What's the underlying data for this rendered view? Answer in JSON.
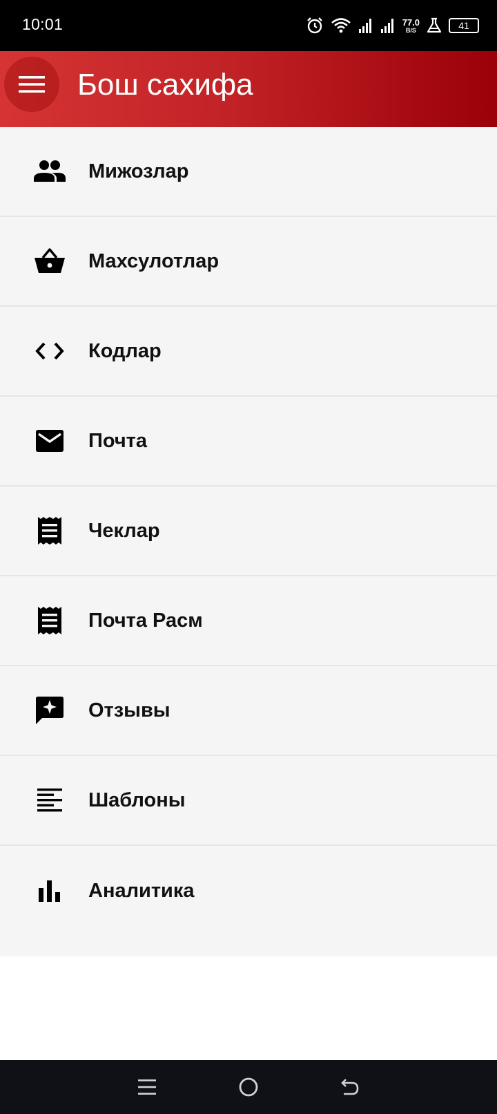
{
  "status_bar": {
    "time": "10:01",
    "net_speed": "77.0",
    "net_unit": "B/S",
    "battery": "41"
  },
  "app_bar": {
    "title": "Бош сахифа",
    "menu_icon": "hamburger-menu-icon"
  },
  "menu": {
    "items": [
      {
        "label": "Мижозлар",
        "icon": "people-icon"
      },
      {
        "label": "Махсулотлар",
        "icon": "basket-icon"
      },
      {
        "label": "Кодлар",
        "icon": "code-icon"
      },
      {
        "label": "Почта",
        "icon": "mail-icon"
      },
      {
        "label": "Чеклар",
        "icon": "receipt-icon"
      },
      {
        "label": "Почта Расм",
        "icon": "receipt-icon"
      },
      {
        "label": "Отзывы",
        "icon": "review-icon"
      },
      {
        "label": "Шаблоны",
        "icon": "text-lines-icon"
      },
      {
        "label": "Аналитика",
        "icon": "bar-chart-icon"
      }
    ]
  },
  "colors": {
    "app_bar_start": "#d63434",
    "app_bar_end": "#9b0008",
    "list_background": "#f5f5f5",
    "nav_bar": "#0f1117"
  }
}
